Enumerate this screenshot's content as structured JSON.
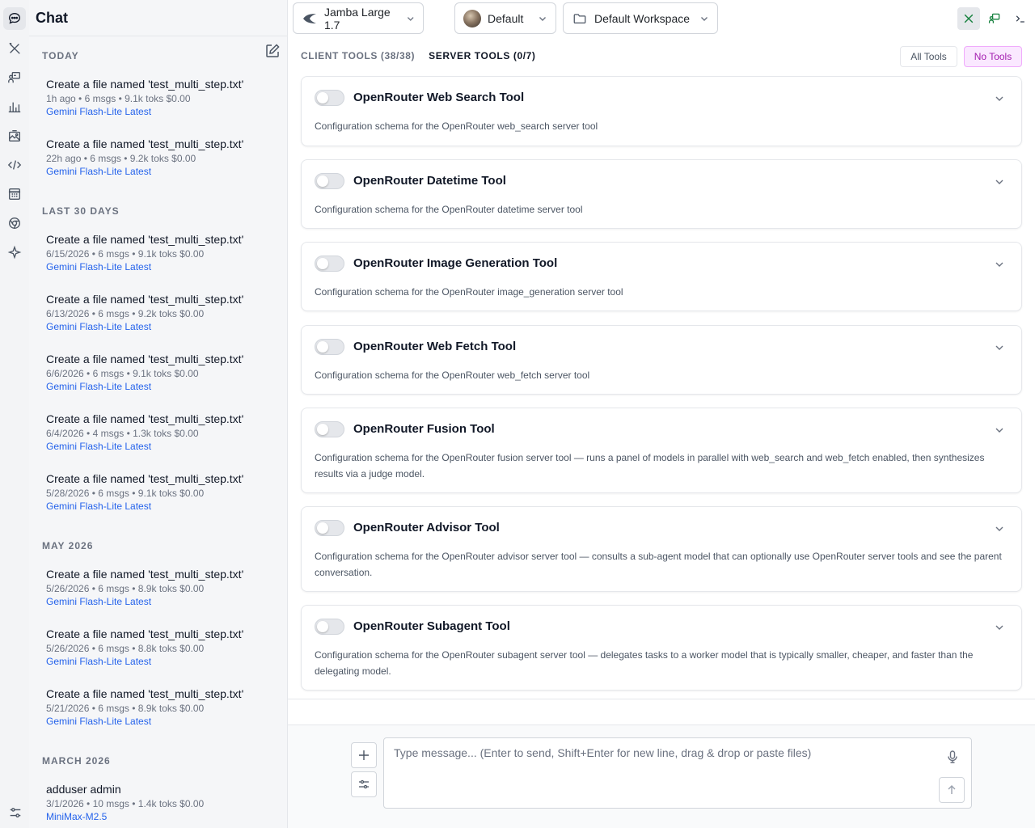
{
  "sidebar": {
    "title": "Chat",
    "groups": [
      {
        "label": "TODAY"
      },
      {
        "label": "LAST 30 DAYS"
      },
      {
        "label": "MAY 2026"
      },
      {
        "label": "MARCH 2026"
      }
    ],
    "conversations": [
      {
        "title": "Create a file named 'test_multi_step.txt'",
        "meta": "1h ago • 6 msgs • 9.1k toks $0.00",
        "model": "Gemini Flash-Lite Latest"
      },
      {
        "title": "Create a file named 'test_multi_step.txt'",
        "meta": "22h ago • 6 msgs • 9.2k toks $0.00",
        "model": "Gemini Flash-Lite Latest"
      },
      {
        "title": "Create a file named 'test_multi_step.txt'",
        "meta": "6/15/2026 • 6 msgs • 9.1k toks $0.00",
        "model": "Gemini Flash-Lite Latest"
      },
      {
        "title": "Create a file named 'test_multi_step.txt'",
        "meta": "6/13/2026 • 6 msgs • 9.2k toks $0.00",
        "model": "Gemini Flash-Lite Latest"
      },
      {
        "title": "Create a file named 'test_multi_step.txt'",
        "meta": "6/6/2026 • 6 msgs • 9.1k toks $0.00",
        "model": "Gemini Flash-Lite Latest"
      },
      {
        "title": "Create a file named 'test_multi_step.txt'",
        "meta": "6/4/2026 • 4 msgs • 1.3k toks $0.00",
        "model": "Gemini Flash-Lite Latest"
      },
      {
        "title": "Create a file named 'test_multi_step.txt'",
        "meta": "5/28/2026 • 6 msgs • 9.1k toks $0.00",
        "model": "Gemini Flash-Lite Latest"
      },
      {
        "title": "Create a file named 'test_multi_step.txt'",
        "meta": "5/26/2026 • 6 msgs • 8.9k toks $0.00",
        "model": "Gemini Flash-Lite Latest"
      },
      {
        "title": "Create a file named 'test_multi_step.txt'",
        "meta": "5/26/2026 • 6 msgs • 8.8k toks $0.00",
        "model": "Gemini Flash-Lite Latest"
      },
      {
        "title": "Create a file named 'test_multi_step.txt'",
        "meta": "5/21/2026 • 6 msgs • 8.9k toks $0.00",
        "model": "Gemini Flash-Lite Latest"
      },
      {
        "title": "adduser admin",
        "meta": "3/1/2026 • 10 msgs • 1.4k toks $0.00",
        "model": "MiniMax-M2.5"
      }
    ]
  },
  "rail_icons": [
    "chat-icon",
    "tools-icon",
    "agents-icon",
    "stats-icon",
    "gallery-icon",
    "code-icon",
    "calculator-icon",
    "browser-icon",
    "sparkle-icon"
  ],
  "topbar": {
    "model": "Jamba Large 1.7",
    "persona": "Default",
    "workspace": "Default Workspace"
  },
  "tabs": {
    "client": "CLIENT TOOLS (38/38)",
    "server": "SERVER TOOLS (0/7)"
  },
  "filters": {
    "all": "All Tools",
    "none": "No Tools"
  },
  "tools": [
    {
      "title": "OpenRouter Web Search Tool",
      "desc": "Configuration schema for the OpenRouter web_search server tool",
      "enabled": false
    },
    {
      "title": "OpenRouter Datetime Tool",
      "desc": "Configuration schema for the OpenRouter datetime server tool",
      "enabled": false
    },
    {
      "title": "OpenRouter Image Generation Tool",
      "desc": "Configuration schema for the OpenRouter image_generation server tool",
      "enabled": false
    },
    {
      "title": "OpenRouter Web Fetch Tool",
      "desc": "Configuration schema for the OpenRouter web_fetch server tool",
      "enabled": false
    },
    {
      "title": "OpenRouter Fusion Tool",
      "desc": "Configuration schema for the OpenRouter fusion server tool — runs a panel of models in parallel with web_search and web_fetch enabled, then synthesizes results via a judge model.",
      "enabled": false
    },
    {
      "title": "OpenRouter Advisor Tool",
      "desc": "Configuration schema for the OpenRouter advisor server tool — consults a sub-agent model that can optionally use OpenRouter server tools and see the parent conversation.",
      "enabled": false
    },
    {
      "title": "OpenRouter Subagent Tool",
      "desc": "Configuration schema for the OpenRouter subagent server tool — delegates tasks to a worker model that is typically smaller, cheaper, and faster than the delegating model.",
      "enabled": false
    }
  ],
  "composer": {
    "placeholder": "Type message... (Enter to send, Shift+Enter for new line, drag & drop or paste files)"
  },
  "colors": {
    "accent_green": "#15803d",
    "link_blue": "#2563eb",
    "no_tools_bg": "#fae8ff",
    "no_tools_text": "#a21caf"
  }
}
